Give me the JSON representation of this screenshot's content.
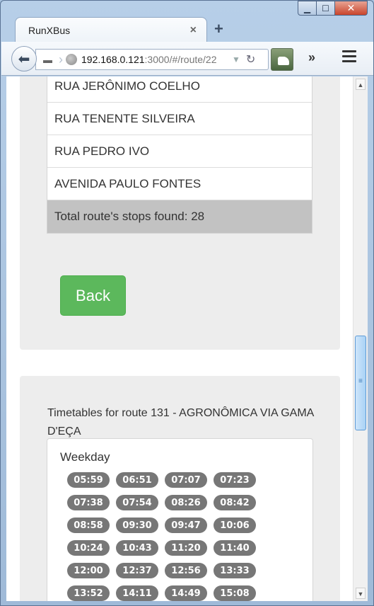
{
  "window": {
    "minimize_label": "▁",
    "maximize_label": "☐",
    "close_label": "✕"
  },
  "tab": {
    "title": "RunXBus",
    "close_label": "×",
    "newtab_label": "+"
  },
  "toolbar": {
    "back_label": "⬅",
    "url_host": "192.168.0.121",
    "url_path": ":3000/#/route/22",
    "overflow_label": "»"
  },
  "stops": {
    "items": [
      "RUA JERÔNIMO COELHO",
      "RUA TENENTE SILVEIRA",
      "RUA PEDRO IVO",
      "AVENIDA PAULO FONTES"
    ],
    "total_label": "Total route's stops found: 28"
  },
  "back_button_label": "Back",
  "timetable": {
    "title": "Timetables for route 131 - AGRONÔMICA VIA GAMA D'EÇA",
    "day": "Weekday",
    "times": [
      "05:59",
      "06:51",
      "07:07",
      "07:23",
      "07:38",
      "07:54",
      "08:26",
      "08:42",
      "08:58",
      "09:30",
      "09:47",
      "10:06",
      "10:24",
      "10:43",
      "11:20",
      "11:40",
      "12:00",
      "12:37",
      "12:56",
      "13:33",
      "13:52",
      "14:11",
      "14:49",
      "15:08"
    ]
  }
}
